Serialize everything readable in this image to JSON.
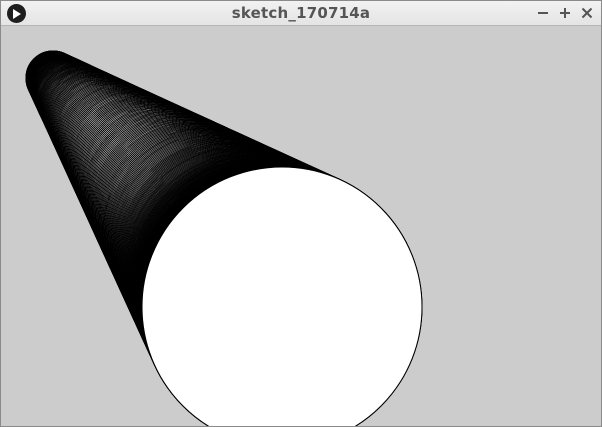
{
  "window": {
    "title": "sketch_170714a",
    "icons": {
      "app": "play-circle-icon",
      "minimize": "minimize-icon",
      "maximize": "maximize-icon",
      "close": "close-icon"
    },
    "colors": {
      "canvas_background": "#cccccc",
      "stroke": "#000000",
      "fill": "#ffffff"
    }
  }
}
